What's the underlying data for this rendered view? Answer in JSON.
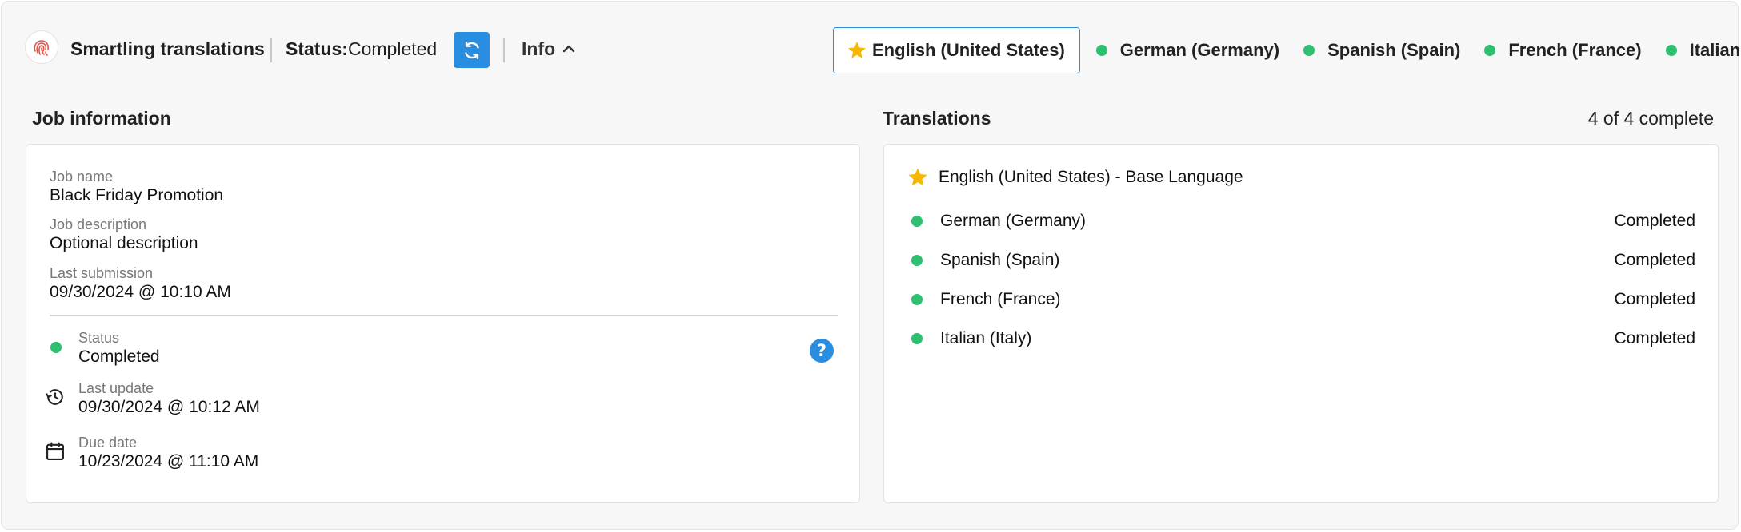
{
  "header": {
    "app_title": "Smartling translations",
    "status_label": "Status:",
    "status_value": "Completed",
    "info_label": "Info"
  },
  "language_tabs": [
    {
      "label": "English (United States)",
      "icon": "star-icon",
      "active": true
    },
    {
      "label": "German (Germany)",
      "icon": "status-dot",
      "active": false
    },
    {
      "label": "Spanish (Spain)",
      "icon": "status-dot",
      "active": false
    },
    {
      "label": "French (France)",
      "icon": "status-dot",
      "active": false
    },
    {
      "label": "Italian (Italy)",
      "icon": "status-dot",
      "active": false
    }
  ],
  "job": {
    "section_title": "Job information",
    "name_label": "Job name",
    "name_value": "Black Friday Promotion",
    "description_label": "Job description",
    "description_value": "Optional description",
    "last_submission_label": "Last submission",
    "last_submission_value": "09/30/2024 @ 10:10 AM",
    "status_label": "Status",
    "status_value": "Completed",
    "last_update_label": "Last update",
    "last_update_value": "09/30/2024 @ 10:12 AM",
    "due_date_label": "Due date",
    "due_date_value": "10/23/2024 @ 11:10 AM",
    "help_glyph": "?"
  },
  "translations": {
    "section_title": "Translations",
    "summary": "4 of 4 complete",
    "base_language": "English (United States) - Base Language",
    "rows": [
      {
        "language": "German (Germany)",
        "status": "Completed"
      },
      {
        "language": "Spanish (Spain)",
        "status": "Completed"
      },
      {
        "language": "French (France)",
        "status": "Completed"
      },
      {
        "language": "Italian (Italy)",
        "status": "Completed"
      }
    ]
  },
  "colors": {
    "accent_blue": "#2a8ee0",
    "status_green": "#2fbf71",
    "star_yellow": "#f5b800",
    "logo_red": "#e2554a"
  }
}
